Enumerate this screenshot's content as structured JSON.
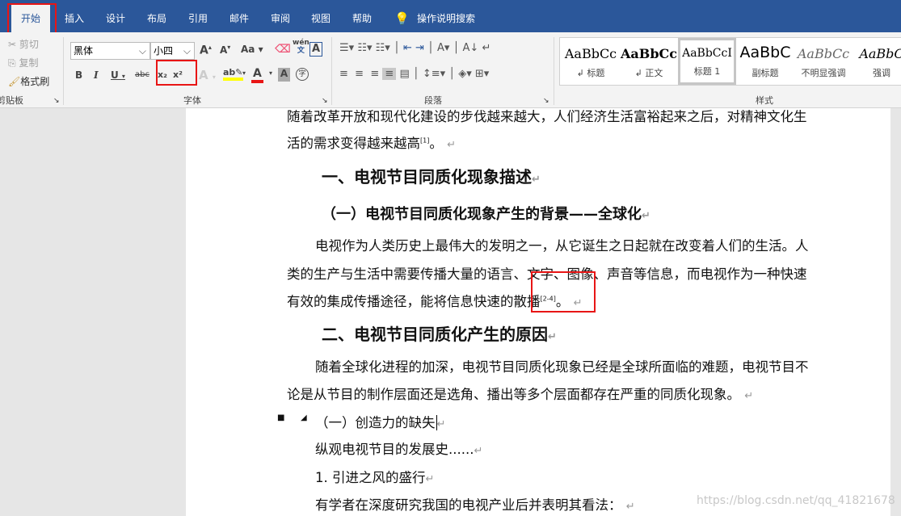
{
  "tabs": [
    {
      "label": "开始"
    },
    {
      "label": "插入"
    },
    {
      "label": "设计"
    },
    {
      "label": "布局"
    },
    {
      "label": "引用"
    },
    {
      "label": "邮件"
    },
    {
      "label": "审阅"
    },
    {
      "label": "视图"
    },
    {
      "label": "帮助"
    }
  ],
  "search_label": "操作说明搜索",
  "clipboard": {
    "cut": "剪切",
    "copy": "复制",
    "format_painter": "格式刷",
    "group": "剪贴板"
  },
  "font": {
    "name": "黑体",
    "size": "小四",
    "group": "字体",
    "change_case": "Aa",
    "phonetic_top": "wén",
    "phonetic_bottom": "文",
    "strike": "abc",
    "subscript": "x₂",
    "superscript": "x²"
  },
  "paragraph": {
    "group": "段落"
  },
  "styles": {
    "group": "样式",
    "items": [
      {
        "preview": "AaBbCc",
        "name": "↲ 标题"
      },
      {
        "preview": "AaBbCc",
        "name": "↲ 正文"
      },
      {
        "preview": "AaBbCcI",
        "name": "标题 1"
      },
      {
        "preview": "AaBbC",
        "name": "副标题"
      },
      {
        "preview": "AaBbCc",
        "name": "不明显强调"
      },
      {
        "preview": "AaBbC",
        "name": "强调"
      }
    ]
  },
  "colors": {
    "accent": "#2b579a",
    "highlight": "#ffff00",
    "font_color": "#e81515",
    "annotation": "#e81515"
  },
  "document": {
    "l1": "随着改革开放和现代化建设的步伐越来越大，人们经济生活富裕起来之后，对精神文化生",
    "l2": "活的需求变得越来越高",
    "l2_ref": "[1]",
    "l2_end": "。",
    "h1a": "一、电视节目同质化现象描述",
    "h2a": "（一）电视节目同质化现象产生的背景——全球化",
    "p1": "电视作为人类历史上最伟大的发明之一，从它诞生之日起就在改变着人们的生活。人",
    "p2": "类的生产与生活中需要传播大量的语言、文字、图像、声音等信息，而电视作为一种快速",
    "p3": "有效的集成传播途径，能将信息快速的散播",
    "p3_ref": "[2-4]",
    "p3_end": "。",
    "h1b": "二、电视节目同质化产生的原因",
    "p4": "随着全球化进程的加深，电视节目同质化现象已经是全球所面临的难题，电视节目不",
    "p5": "论是从节目的制作层面还是选角、播出等多个层面都存在严重的同质化现象。",
    "h2b": "（一）创造力的缺失",
    "p6": "纵观电视节目的发展史......",
    "p7": "1. 引进之风的盛行",
    "p8": "有学者在深度研究我国的电视产业后并表明其看法："
  },
  "watermark": "https://blog.csdn.net/qq_41821678"
}
